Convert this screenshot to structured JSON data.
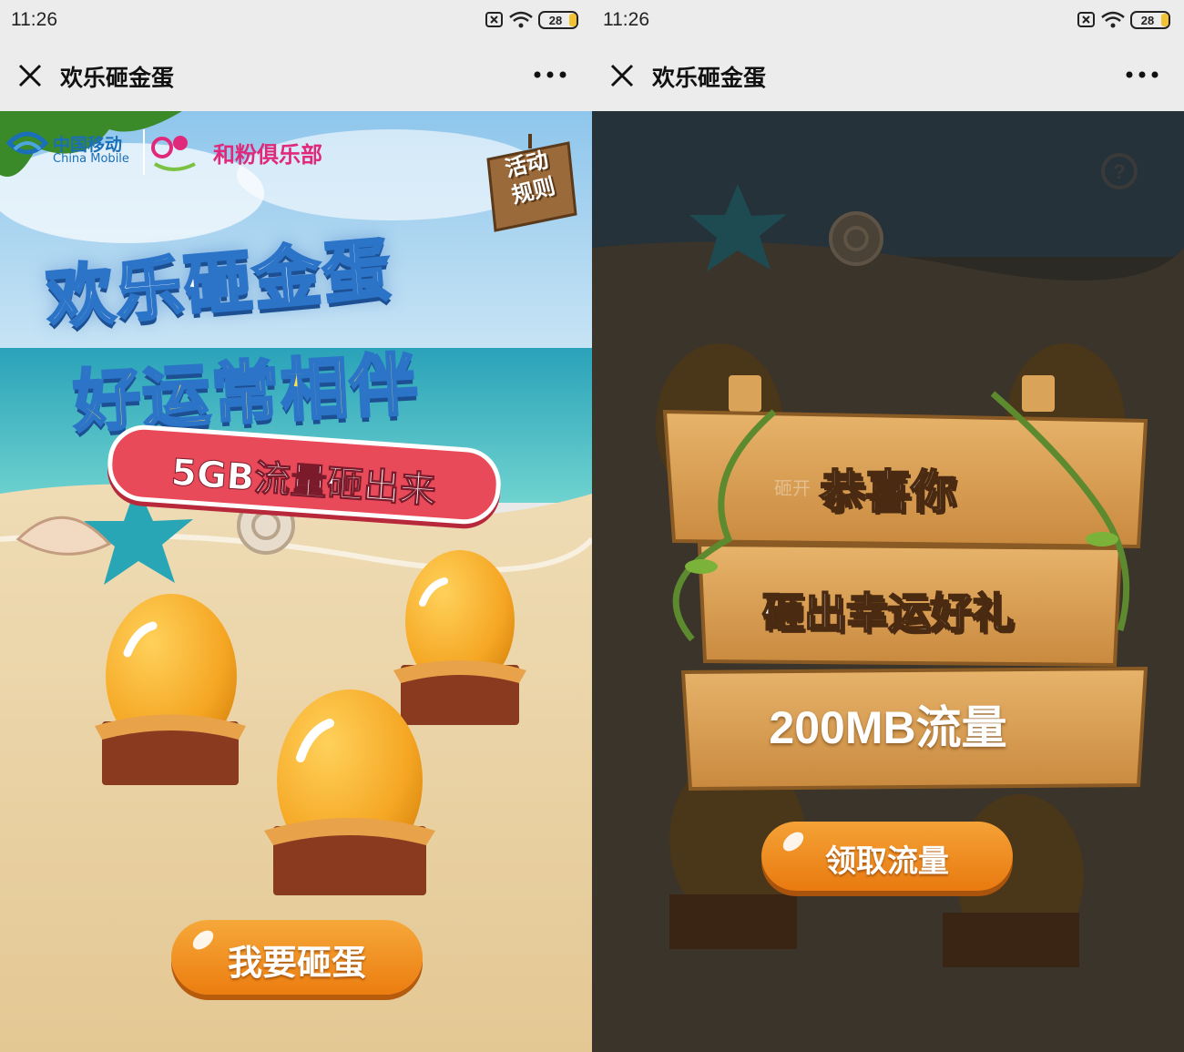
{
  "status_bar": {
    "time": "11:26",
    "battery": "28"
  },
  "left_screen": {
    "nav": {
      "title": "欢乐砸金蛋"
    },
    "brand": {
      "china_mobile_cn": "中国移动",
      "china_mobile_en": "China Mobile",
      "club_name": "和粉俱乐部"
    },
    "rules_sign": {
      "line1": "活动",
      "line2": "规则"
    },
    "headline": {
      "line1": "欢乐砸金蛋",
      "line2": "好运常相伴",
      "subtitle": "5GB流量砸出来"
    },
    "action_button": {
      "label": "我要砸蛋"
    }
  },
  "right_screen": {
    "nav": {
      "title": "欢乐砸金蛋"
    },
    "prize_dialog": {
      "background_hint": "砸开",
      "sign1": "恭喜你",
      "sign2": "砸出幸运好礼",
      "prize": "200MB流量",
      "claim_button": "领取流量"
    }
  },
  "colors": {
    "accent_orange": "#ec7d10",
    "brand_blue": "#2b74c8",
    "club_pink": "#e0297a",
    "wood": "#d79a4c"
  }
}
